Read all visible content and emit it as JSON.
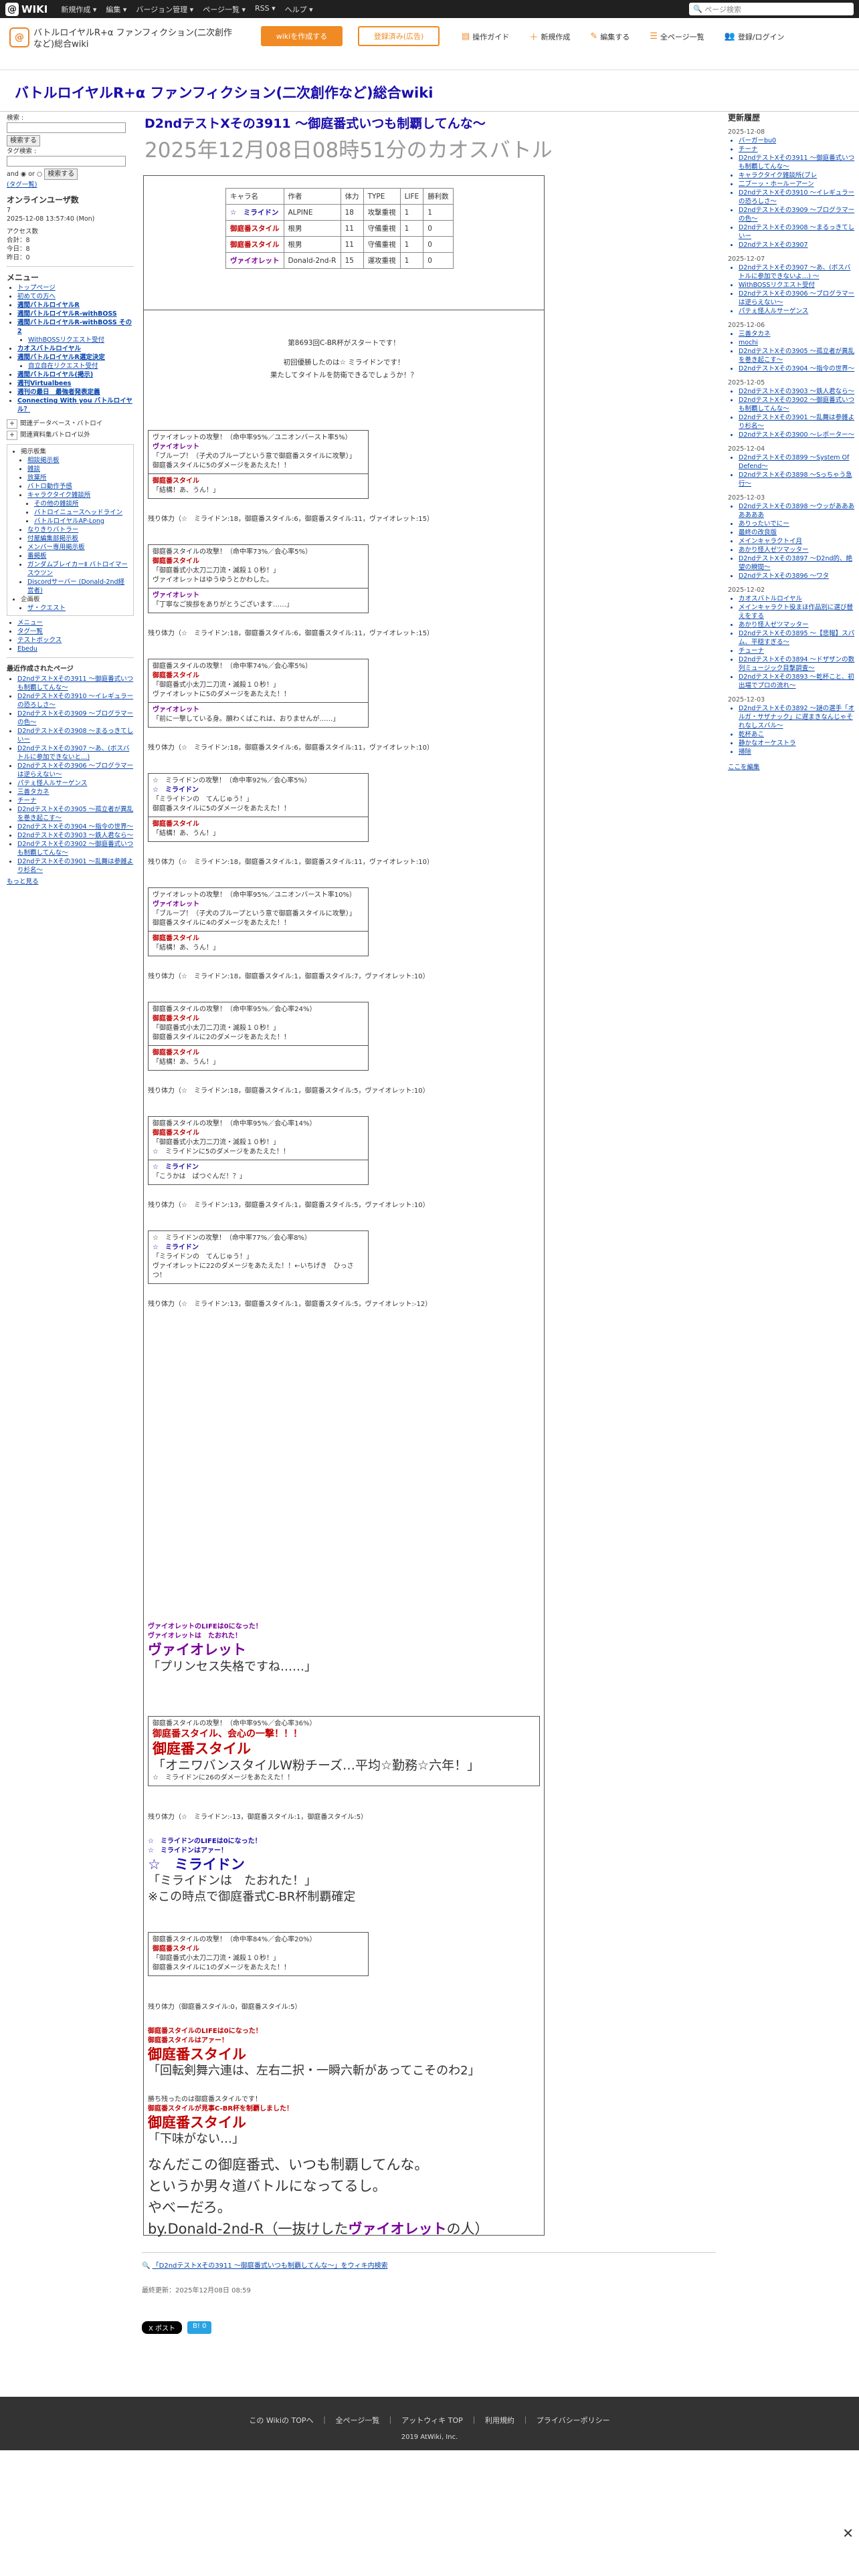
{
  "topbar": {
    "logo": "WIKI",
    "menu": [
      "新規作成 ▾",
      "編集 ▾",
      "バージョン管理 ▾",
      "ページ一覧 ▾",
      "RSS ▾",
      "ヘルプ ▾"
    ],
    "search_placeholder": "ページ検索"
  },
  "header": {
    "site_name": "バトルロイヤルR+α ファンフィクション(二次創作など)総合wiki",
    "btn_wiki": "wikiを作成する",
    "btn_ad": "登録済み(広告)",
    "nav": [
      "操作ガイド",
      "新規作成",
      "編集する",
      "全ページ一覧",
      "登録/ログイン"
    ]
  },
  "site_title": "バトルロイヤルR+α ファンフィクション(二次創作など)総合wiki",
  "page": {
    "title": "D2ndテストXその3911 ～御庭番式いつも制覇してんな～",
    "subtitle": "2025年12月08日08時51分のカオスバトル"
  },
  "left": {
    "search_label": "検索 :",
    "search_btn": "検索する",
    "tag_label": "タグ検索 :",
    "and": "and",
    "or": "or",
    "search_btn2": "検索する",
    "tag_cloud": "(タグ一覧)",
    "online_title": "オンラインユーザ数",
    "online_count": "7",
    "online_date": "2025-12-08 13:57:40 (Mon)",
    "access": [
      "アクセス数",
      "合計：8",
      "今日：8",
      "昨日：0"
    ],
    "menu_title": "メニュー",
    "menu_items": [
      "トップページ",
      "初めての方へ",
      "週間バトルロイヤルR",
      "週間バトルロイヤルR-withBOSS",
      "週間バトルロイヤルR-withBOSS その2",
      "WithBOSSリクエスト受付",
      "カオスバトルロイヤル",
      "週間バトルロイヤルR選定決定",
      "自立自在リクエスト受付",
      "週間バトルロイヤル(掲示)",
      "週刊Virtualbees",
      "週刊の最日　最強者発表定義",
      "Connecting With you バトルロイヤル？"
    ],
    "expand": [
      "関連データベース・バトロイ",
      "関連資料集バトロイ以外"
    ],
    "links_title": "掲示板集",
    "links": [
      "相談掲示板",
      "雑談",
      "放棄所",
      "バトロ動作予感",
      "キャラクタイク雑談所",
      "その他の雑談所",
      "バトロイニュースヘッドライン",
      "バトルロイヤルAP-Long",
      "なりきりバトラー",
      "付屋編集部掲示板",
      "メンバー専用掲示板",
      "番掲板",
      "ガンダムブレイカーⅡ バトロイマースウツン",
      "Discordサーバー (Donald-2nd経営者)",
      "企画板",
      "ザ・クエスト"
    ],
    "misc": [
      "メニュー",
      "タグ一覧",
      "テストボックス",
      "Ebedu"
    ],
    "recent_title": "最近作成されたページ",
    "recent": [
      "D2ndテストXその3911 ～御庭番式いつも制覇してんな～",
      "D2ndテストXその3910 ～イレギュラーの恐ろしさ～",
      "D2ndテストXその3909 ～ブログラマーの色～",
      "D2ndテストXその3908 ～まるっきてしいー",
      "D2ndテストXその3907 ～あ、(ボスバトルに参加できないと…)",
      "D2ndテストXその3906 ～ブログラマーは逆らえない～",
      "パテぇ怪人ルサーゲンス",
      "三善タカネ",
      "チーナ",
      "D2ndテストXその3905 ～孤立者が異乱を巻き起こす～",
      "D2ndテストXその3904 ～指令の世界～",
      "D2ndテストXその3903 ～鉄人君なら～",
      "D2ndテストXその3902 ～御庭番式いつも制覇してんな～",
      "D2ndテストXその3901 ～乱舞は参雑より杉名～"
    ],
    "more": "もっと見る"
  },
  "right": {
    "title": "更新履歴",
    "days": [
      {
        "date": "2025-12-08",
        "items": [
          "バーガーbu0",
          "チーナ",
          "D2ndテストXその3911 ～御庭番式いつも制覇してんな～",
          "キャラクタイク雑談所(ブレ",
          "二ブーッ・ホールーアーン",
          "D2ndテストXその3910 ～イレギュラーの恐ろしさ～",
          "D2ndテストXその3909 ～ブログラマーの色～",
          "D2ndテストXその3908 ～まるっきてしいー",
          "D2ndテストXその3907"
        ]
      },
      {
        "date": "2025-12-07",
        "items": [
          "D2ndテストXその3907 ～あ、(ボスバトルに参加できないよ…) ～",
          "WithBOSSリクエスト受付",
          "D2ndテストXその3906 ～ブログラマーは逆らえない～",
          "パテぇ怪人ルサーゲンス"
        ]
      },
      {
        "date": "2025-12-06",
        "items": [
          "三善タカネ",
          "mochi",
          "D2ndテストXその3905 ～孤立者が異乱を巻き起こす～",
          "D2ndテストXその3904 ～指令の世界～"
        ]
      },
      {
        "date": "2025-12-05",
        "items": [
          "D2ndテストXその3903 ～鉄人君なら～",
          "D2ndテストXその3902 ～御庭番式いつも制覇してんな～",
          "D2ndテストXその3901 ～乱舞は参雑より杉名～",
          "D2ndテストXその3900 ～レポーター～"
        ]
      },
      {
        "date": "2025-12-04",
        "items": [
          "D2ndテストXその3899 ～System Of Defend～",
          "D2ndテストXその3898 ～Sっちゃう急行～"
        ]
      },
      {
        "date": "2025-12-03",
        "items": [
          "D2ndテストXその3898 ～ウッがあああああああ",
          "ありったいでにー",
          "最終の改良版",
          "メインキャラクトイ月",
          "あかり怪人ゼツマッター",
          "D2ndテストXその3897 ～D2nd的、絶望の瞬間～",
          "D2ndテストXその3896 ～ワタ"
        ]
      },
      {
        "date": "2025-12-02",
        "items": [
          "カオスバトルロイヤル",
          "メインキャラクト役まほ作品別に選び替えをする",
          "あかり怪人ゼツマッター",
          "D2ndテストXその3895 ～【悲報】スパム、平穏すぎる～",
          "チューナ",
          "D2ndテストXその3894 ～ドザザンの数列ミュージック目撃調査～",
          "D2ndテストXその3893 ～乾杯こと、初出場でプロの流れ～"
        ]
      },
      {
        "date": "2025-12-03",
        "items": [
          "D2ndテストXその3892 ～謎の選手「オルガ・サザナック」に遅まきなんじゃそれなしスバル～",
          "乾杯あこ",
          "静かなオーケストラ",
          "掃除"
        ]
      }
    ],
    "more": "ここを編集"
  },
  "battle": {
    "table_rows": [
      [
        "☆　ミライドン",
        "ALPINE",
        "18",
        "攻撃重視",
        "1",
        "1"
      ],
      [
        "御庭番スタイル",
        "根男",
        "11",
        "守備重視",
        "1",
        "0"
      ],
      [
        "御庭番スタイル",
        "根男",
        "11",
        "守備重視",
        "1",
        "0"
      ],
      [
        "ヴァイオレット",
        "Donald-2nd-R",
        "15",
        "運攻重視",
        "1",
        "0"
      ]
    ],
    "table_head": [
      "キャラ名",
      "作者",
      "体力",
      "TYPE",
      "LIFE",
      "勝利数"
    ],
    "start1": "第8693回C-BR杯がスタートです！",
    "start2": "初回優勝したのは☆ ミライドンです！",
    "start3": "果たしてタイトルを防衛できるでしょうか！？",
    "log": [
      {
        "lines": [
          "ヴァイオレットの攻撃！（命中率95%／ユニオンバースト率5%）",
          "ヴァイオレット",
          "「ブループ！（子犬のブループという意で御庭番スタイルに攻撃）」",
          "御庭番スタイルに5のダメージをあたえた！！"
        ],
        "reply": [
          "御庭番スタイル",
          "「結構！あ、うん！」"
        ]
      },
      {
        "remain": "残り体力（☆　ミライドン:18，御庭番スタイル:6，御庭番スタイル:11，ヴァイオレット:15）"
      },
      {
        "lines": [
          "御庭番スタイルの攻撃！（命中率73%／会心率5%）",
          "御庭番スタイル",
          "「御庭番式小太刀二刀流・滅殺１０秒！」",
          "ヴァイオレットはゆうゆうとかわした。"
        ],
        "reply": [
          "ヴァイオレット",
          "「丁寧なご挨拶をありがとうございます……」"
        ]
      },
      {
        "remain": "残り体力（☆　ミライドン:18，御庭番スタイル:6，御庭番スタイル:11，ヴァイオレット:15）"
      },
      {
        "lines": [
          "御庭番スタイルの攻撃！（命中率74%／会心率5%）",
          "御庭番スタイル",
          "「御庭番式小太刀二刀流・滅殺１０秒！」",
          "ヴァイオレットに5のダメージをあたえた！！"
        ],
        "reply": [
          "ヴァイオレット",
          "「前に一撃している身。願わくばこれは、おりませんが……」"
        ]
      },
      {
        "remain": "残り体力（☆　ミライドン:18，御庭番スタイル:6，御庭番スタイル:11，ヴァイオレット:10）"
      },
      {
        "lines": [
          "☆　ミライドンの攻撃！（命中率92%／会心率5%）",
          "☆　ミライドン",
          "「ミライドンの　てんじゅう！」",
          "御庭番スタイルに5のダメージをあたえた！！"
        ],
        "reply": [
          "御庭番スタイル",
          "「結構！あ、うん！」"
        ]
      },
      {
        "remain": "残り体力（☆　ミライドン:18，御庭番スタイル:1，御庭番スタイル:11，ヴァイオレット:10）"
      },
      {
        "lines": [
          "ヴァイオレットの攻撃！（命中率95%／ユニオンバースト率10%）",
          "ヴァイオレット",
          "「ブループ！（子犬のブループという意で御庭番スタイルに攻撃）」",
          "御庭番スタイルに4のダメージをあたえた！！"
        ],
        "reply": [
          "御庭番スタイル",
          "「結構！あ、うん！」"
        ]
      },
      {
        "remain": "残り体力（☆　ミライドン:18，御庭番スタイル:1，御庭番スタイル:7，ヴァイオレット:10）"
      },
      {
        "lines": [
          "御庭番スタイルの攻撃！（命中率95%／会心率24%）",
          "御庭番スタイル",
          "「御庭番式小太刀二刀流・滅殺１０秒！」",
          "御庭番スタイルに2のダメージをあたえた！！"
        ],
        "reply": [
          "御庭番スタイル",
          "「結構！あ、うん！」"
        ]
      },
      {
        "remain": "残り体力（☆　ミライドン:18，御庭番スタイル:1，御庭番スタイル:5，ヴァイオレット:10）"
      },
      {
        "lines": [
          "御庭番スタイルの攻撃！（命中率95%／会心率14%）",
          "御庭番スタイル",
          "「御庭番式小太刀二刀流・滅殺１０秒！」",
          "☆　ミライドンに5のダメージをあたえた！！"
        ],
        "reply": [
          "☆　ミライドン",
          "「こうかは　ばつぐんだ！？」"
        ]
      },
      {
        "remain": "残り体力（☆　ミライドン:13，御庭番スタイル:1，御庭番スタイル:5，ヴァイオレット:10）"
      },
      {
        "lines": [
          "☆　ミライドンの攻撃！（命中率77%／会心率8%）",
          "☆　ミライドン",
          "「ミライドンの　てんじゅう！」",
          "ヴァイオレットに22のダメージをあたえた！！←いちげき　ひっさつ！"
        ],
        "reply": []
      },
      {
        "remain": "残り体力（☆　ミライドン:13，御庭番スタイル:1，御庭番スタイル:5，ヴァイオレット:-12）"
      }
    ],
    "ko1a": "ヴァイオレットのLIFEは0になった！",
    "ko1b": "ヴァイオレットは　たおれた！",
    "ko1name": "ヴァイオレット",
    "ko1quote": "「プリンセス失格ですね……」",
    "crit_head": "御庭番スタイルの攻撃！（命中率95%／会心率36%）",
    "crit_line": "御庭番スタイル、会心の一撃！！！",
    "crit_name": "御庭番スタイル",
    "crit_quote": "「オニワバンスタイルW粉チーズ…平均☆勤務☆六年！」",
    "crit_dmg": "☆　ミライドンに26のダメージをあたえた！！",
    "remain_after": "残り体力（☆　ミライドン:-13，御庭番スタイル:1，御庭番スタイル:5）",
    "ko2a": "☆　ミライドンのLIFEは0になった！",
    "ko2b": "☆　ミライドンはアァー！",
    "ko2name": "☆　ミライドン",
    "ko2quote": "「ミライドンは　たおれた！」",
    "ko2note": "※この時点で御庭番式C-BR杯制覇確定",
    "last_lines": [
      "御庭番スタイルの攻撃！（命中率84%／会心率20%）",
      "御庭番スタイル",
      "「御庭番式小太刀二刀流・滅殺１０秒！」",
      "御庭番スタイルに1のダメージをあたえた！！"
    ],
    "remain_last": "残り体力（御庭番スタイル:0，御庭番スタイル:5）",
    "ko3a": "御庭番スタイルのLIFEは0になった！",
    "ko3b": "御庭番スタイルはアァー！",
    "ko3name": "御庭番スタイル",
    "ko3quote": "「回転剣舞六連は、左右二択・一瞬六斬があってこそのわ2」",
    "win1": "勝ち残ったのは御庭番スタイルです！",
    "win2": "御庭番スタイルが見事C-BR杯を制覇しました！",
    "win_name": "御庭番スタイル",
    "win_quote": "「下味がない…」",
    "end1": "なんだこの御庭番式、いつも制覇してんな。",
    "end2": "というか男々道バトルになってるし。",
    "end3": "やべーだろ。",
    "end4a": "by.Donald-2nd-R（一抜けした",
    "end4b": "ヴァイオレット",
    "end4c": "の人）"
  },
  "share": "「D2ndテストXその3911 ～御庭番式いつも制覇してんな～」をウィキ内検索",
  "updated": "最終更新：2025年12月08日 08:59",
  "tweet": "X ポスト",
  "hatena": "B! 0",
  "footer": {
    "links": "この Wikiの TOPへ　｜　全ページ一覧　｜　アットウィキ TOP　｜　利用規約　｜　プライバシーポリシー",
    "copy": "2019 AtWiki, Inc."
  },
  "close": "✕"
}
